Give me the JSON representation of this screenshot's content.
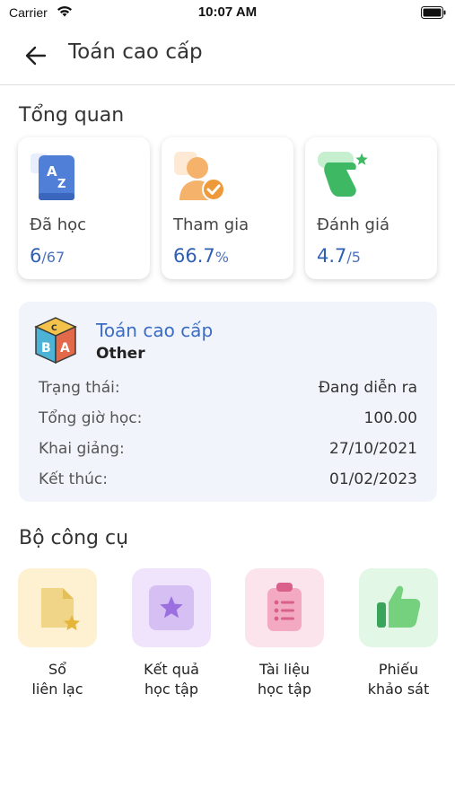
{
  "status_bar": {
    "carrier": "Carrier",
    "time": "10:07 AM"
  },
  "nav": {
    "title": "Toán cao cấp"
  },
  "overview": {
    "title": "Tổng quan",
    "cards": [
      {
        "label": "Đã học",
        "value": "6",
        "suffix": "/67",
        "icon": "az-book-icon"
      },
      {
        "label": "Tham gia",
        "value": "66.7",
        "suffix": "%",
        "icon": "user-check-icon"
      },
      {
        "label": "Đánh giá",
        "value": "4.7",
        "suffix": "/5",
        "icon": "rating-hand-icon"
      }
    ]
  },
  "course": {
    "name": "Toán cao cấp",
    "category": "Other",
    "rows": [
      {
        "key": "Trạng thái:",
        "value": "Đang diễn ra"
      },
      {
        "key": "Tổng giờ học:",
        "value": "100.00"
      },
      {
        "key": "Khai giảng:",
        "value": "27/10/2021"
      },
      {
        "key": "Kết thúc:",
        "value": "01/02/2023"
      }
    ]
  },
  "tools": {
    "title": "Bộ công cụ",
    "items": [
      {
        "line1": "Sổ",
        "line2": "liên lạc",
        "icon": "contact-book-icon",
        "bg": "#fdf1d2"
      },
      {
        "line1": "Kết quả",
        "line2": "học tập",
        "icon": "star-badge-icon",
        "bg": "#efe4fb"
      },
      {
        "line1": "Tài liệu",
        "line2": "học tập",
        "icon": "clipboard-icon",
        "bg": "#fce4ec"
      },
      {
        "line1": "Phiếu",
        "line2": "khảo sát",
        "icon": "thumbs-up-icon",
        "bg": "#e3f7e6"
      }
    ]
  },
  "colors": {
    "accent": "#3b6cc4",
    "card_bg": "#f2f4fb"
  }
}
